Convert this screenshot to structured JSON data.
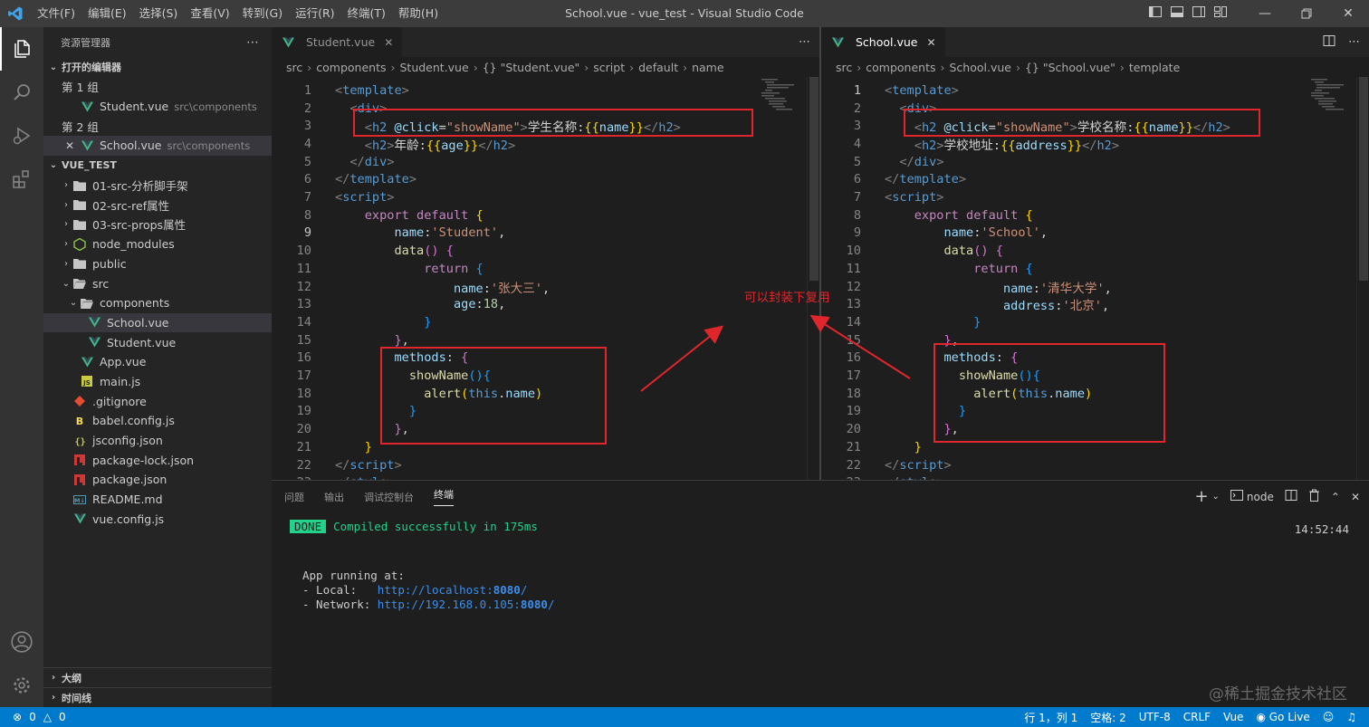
{
  "window": {
    "title": "School.vue - vue_test - Visual Studio Code",
    "menu": [
      "文件(F)",
      "编辑(E)",
      "选择(S)",
      "查看(V)",
      "转到(G)",
      "运行(R)",
      "终端(T)",
      "帮助(H)"
    ]
  },
  "sidebar": {
    "header": "资源管理器",
    "open_editors_title": "打开的编辑器",
    "group1_label": "第 1 组",
    "group1_file": "Student.vue",
    "group1_path": "src\\components",
    "group2_label": "第 2 组",
    "group2_file": "School.vue",
    "group2_path": "src\\components",
    "project_title": "VUE_TEST",
    "tree": [
      {
        "label": "01-src-分析脚手架",
        "type": "folder"
      },
      {
        "label": "02-src-ref属性",
        "type": "folder"
      },
      {
        "label": "03-src-props属性",
        "type": "folder"
      },
      {
        "label": "node_modules",
        "type": "node_modules"
      },
      {
        "label": "public",
        "type": "folder"
      },
      {
        "label": "src",
        "type": "folder-open"
      },
      {
        "label": "components",
        "type": "folder-open"
      },
      {
        "label": "School.vue",
        "type": "vue"
      },
      {
        "label": "Student.vue",
        "type": "vue"
      },
      {
        "label": "App.vue",
        "type": "vue"
      },
      {
        "label": "main.js",
        "type": "js"
      },
      {
        "label": ".gitignore",
        "type": "git"
      },
      {
        "label": "babel.config.js",
        "type": "babel"
      },
      {
        "label": "jsconfig.json",
        "type": "json"
      },
      {
        "label": "package-lock.json",
        "type": "npm"
      },
      {
        "label": "package.json",
        "type": "npm"
      },
      {
        "label": "README.md",
        "type": "md"
      },
      {
        "label": "vue.config.js",
        "type": "vue"
      }
    ],
    "outline_title": "大纲",
    "timeline_title": "时间线"
  },
  "editor1": {
    "tab": "Student.vue",
    "breadcrumb": [
      "src",
      "components",
      "Student.vue",
      "{} \"Student.vue\"",
      "script",
      "default",
      "name"
    ],
    "cursor_line": 9
  },
  "editor2": {
    "tab": "School.vue",
    "breadcrumb": [
      "src",
      "components",
      "School.vue",
      "{} \"School.vue\"",
      "template"
    ],
    "cursor_line": 1
  },
  "annotation": {
    "text": "可以封装下复用",
    "color": "#e0262d"
  },
  "panel": {
    "tabs": [
      "问题",
      "输出",
      "调试控制台",
      "终端"
    ],
    "active_tab": "终端",
    "shell": "node",
    "done_badge": "DONE",
    "compiled": "Compiled successfully in 175ms",
    "time": "14:52:44",
    "app_running": "App running at:",
    "local_label": "- Local:   ",
    "local_url": "http://localhost:",
    "local_port": "8080",
    "network_label": "- Network: ",
    "network_url": "http://192.168.0.105:",
    "network_port": "8080",
    "watermark": "@稀土掘金技术社区"
  },
  "statusbar": {
    "errors": "0",
    "warnings": "0",
    "position": "行 1，列 1",
    "spaces": "空格: 2",
    "encoding": "UTF-8",
    "eol": "CRLF",
    "language": "Vue",
    "golive": "Go Live"
  },
  "colors": {
    "accent": "#007acc",
    "annotation": "#e0262d",
    "done": "#23d18b"
  }
}
